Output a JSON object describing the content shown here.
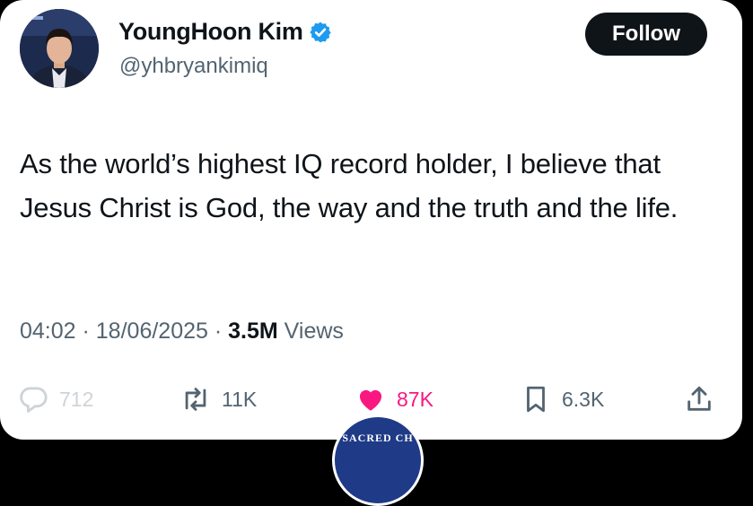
{
  "profile": {
    "display_name": "YoungHoon Kim",
    "handle": "@yhbryankimiq",
    "verified": true,
    "avatar_icon": "avatar-photo"
  },
  "follow_button": {
    "label": "Follow"
  },
  "tweet": {
    "text": "As the world’s highest IQ record holder, I believe that Jesus Christ is God, the way and the truth and the life."
  },
  "meta": {
    "time": "04:02",
    "separator": " · ",
    "date": "18/06/2025",
    "views_count": "3.5M",
    "views_label": " Views"
  },
  "actions": {
    "replies": {
      "icon": "reply-icon",
      "count": "712"
    },
    "reposts": {
      "icon": "repost-icon",
      "count": "11K"
    },
    "likes": {
      "icon": "heart-icon",
      "count": "87K",
      "liked": true
    },
    "bookmarks": {
      "icon": "bookmark-icon",
      "count": "6.3K"
    },
    "share": {
      "icon": "share-icon"
    }
  },
  "watermark": {
    "text": "SACRED CH"
  },
  "colors": {
    "text_primary": "#0f1419",
    "text_secondary": "#536471",
    "like_pink": "#f91880",
    "verified_blue": "#1d9bf0",
    "follow_bg": "#0f1419",
    "watermark_blue": "#1f3a86"
  }
}
